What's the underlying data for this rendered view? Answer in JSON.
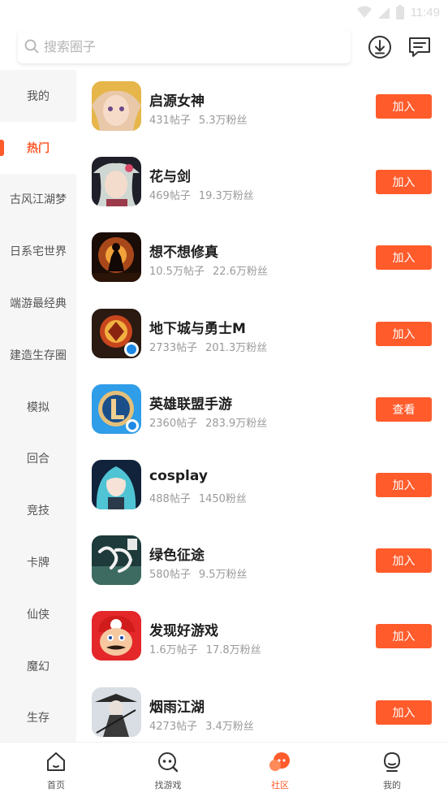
{
  "status_bar": {
    "time": "11:49"
  },
  "search": {
    "placeholder": "搜索圈子"
  },
  "header": {
    "download_icon": "download-circle-icon",
    "messages_icon": "chat-lines-icon"
  },
  "sidebar": {
    "items": [
      {
        "label": "我的"
      },
      {
        "label": "热门",
        "active": true
      },
      {
        "label": "古风江湖梦"
      },
      {
        "label": "日系宅世界"
      },
      {
        "label": "端游最经典"
      },
      {
        "label": "建造生存圈"
      },
      {
        "label": "模拟"
      },
      {
        "label": "回合"
      },
      {
        "label": "竞技"
      },
      {
        "label": "卡牌"
      },
      {
        "label": "仙侠"
      },
      {
        "label": "魔幻"
      },
      {
        "label": "生存"
      }
    ]
  },
  "circles": [
    {
      "title": "启源女神",
      "posts": "431帖子",
      "fans": "5.3万粉丝",
      "button": "加入",
      "icon": "anime-girl-avatar"
    },
    {
      "title": "花与剑",
      "posts": "469帖子",
      "fans": "19.3万粉丝",
      "button": "加入",
      "icon": "swordswoman-avatar"
    },
    {
      "title": "想不想修真",
      "posts": "10.5万帖子",
      "fans": "22.6万粉丝",
      "button": "加入",
      "icon": "cultivator-avatar"
    },
    {
      "title": "地下城与勇士M",
      "posts": "2733帖子",
      "fans": "201.3万粉丝",
      "button": "加入",
      "icon": "dnf-logo-avatar"
    },
    {
      "title": "英雄联盟手游",
      "posts": "2360帖子",
      "fans": "283.9万粉丝",
      "button": "查看",
      "icon": "lol-logo-avatar"
    },
    {
      "title": "cosplay",
      "posts": "488帖子",
      "fans": "1450粉丝",
      "button": "加入",
      "icon": "cosplay-avatar"
    },
    {
      "title": "绿色征途",
      "posts": "580帖子",
      "fans": "9.5万粉丝",
      "button": "加入",
      "icon": "calligraphy-avatar"
    },
    {
      "title": "发现好游戏",
      "posts": "1.6万帖子",
      "fans": "17.8万粉丝",
      "button": "加入",
      "icon": "mario-avatar"
    },
    {
      "title": "烟雨江湖",
      "posts": "4273帖子",
      "fans": "3.4万粉丝",
      "button": "加入",
      "icon": "ink-swordsman-avatar"
    }
  ],
  "bottom_nav": [
    {
      "label": "首页",
      "icon": "home-icon"
    },
    {
      "label": "找游戏",
      "icon": "find-game-icon"
    },
    {
      "label": "社区",
      "icon": "community-icon",
      "active": true
    },
    {
      "label": "我的",
      "icon": "profile-icon"
    }
  ],
  "colors": {
    "accent": "#ff5b2b",
    "sidebar_bg": "#f6f6f6",
    "muted_text": "#9a9a9a"
  }
}
